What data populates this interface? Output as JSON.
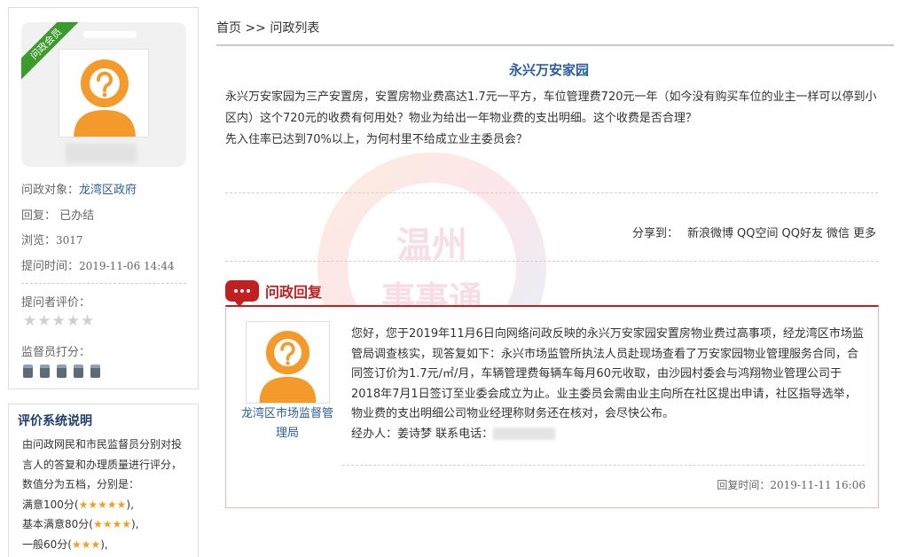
{
  "profile": {
    "badge": "问政会员",
    "target_label": "问政对象：",
    "target_value": "龙湾区政府",
    "reply_label": "回复：",
    "reply_value": "已办结",
    "views_label": "浏览：",
    "views_value": "3017",
    "time_label": "提问时间：",
    "time_value": "2019-11-06 14:44",
    "asker_rating_label": "提问者评价：",
    "asker_rating_stars": "★★★★★",
    "supervisor_label": "监督员打分："
  },
  "rating_info": {
    "title": "评价系统说明",
    "line1": "由问政网民和市民监督员分别对投",
    "line2": "言人的答复和办理质量进行评分，",
    "line3": "数值分为五档，分别是：",
    "level1_label": "满意100分(",
    "level1_stars": "★★★★★",
    "level2_label": "基本满意80分(",
    "level2_stars": "★★★★",
    "level3_label": "一般60分(",
    "level3_stars": "★★★",
    "close": "),"
  },
  "breadcrumb": {
    "home": "首页",
    "sep": " >> ",
    "current": "问政列表"
  },
  "watermark": {
    "line1": "温州",
    "line2": "事事通"
  },
  "question": {
    "title": "永兴万安家园",
    "body": "永兴万安家园为三产安置房，安置房物业费高达1.7元一平方，车位管理费720元一年（如今没有购买车位的业主一样可以停到小区内）这个720元的收费有何用处？物业为给出一年物业费的支出明细。这个收费是否合理？",
    "body2": "先入住率已达到70%以上，为何村里不给成立业主委员会？"
  },
  "share": {
    "label": "分享到：",
    "items": [
      "新浪微博",
      "QQ空间",
      "QQ好友",
      "微信",
      "更多"
    ]
  },
  "reply": {
    "section_title": "问政回复",
    "dept_name": "龙湾区市场监督管理局",
    "text": "您好，您于2019年11月6日向网络问政反映的永兴万安家园安置房物业费过高事项，经龙湾区市场监管局调查核实，现答复如下：永兴市场监管所执法人员赴现场查看了万安家园物业管理服务合同，合同签订价为1.7元/㎡/月，车辆管理费每辆车每月60元收取，由沙园村委会与鸿翔物业管理公司于2018年7月1日签订至业委会成立为止。业主委员会需由业主向所在社区提出申请，社区指导选举，物业费的支出明细公司物业经理称财务还在核对，会尽快公布。",
    "handler": "经办人：姜诗梦  联系电话：",
    "time_label": "回复时间：",
    "time_value": "2019-11-11 16:06"
  },
  "colors": {
    "link": "#2a5d9f",
    "accent_red": "#c0201f",
    "badge_green": "#3d9b2d",
    "avatar_orange": "#f39a2b",
    "star_gold": "#f0a020"
  }
}
